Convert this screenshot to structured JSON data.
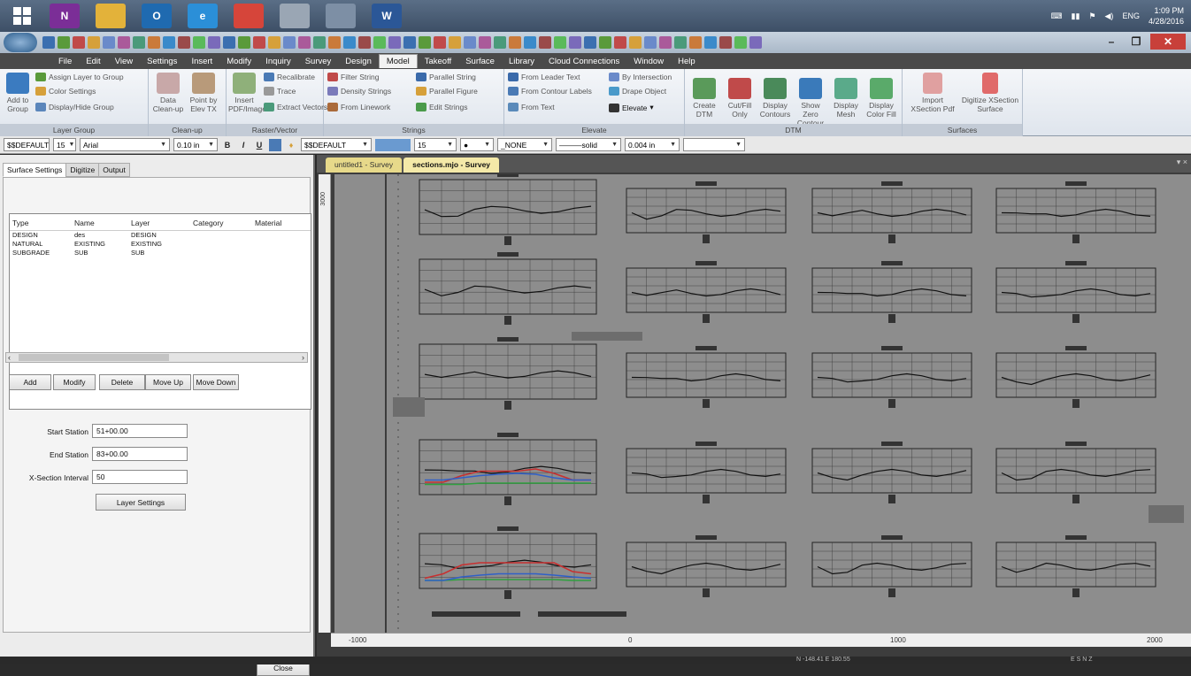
{
  "taskbar": {
    "pinned": [
      {
        "name": "onenote",
        "label": "N",
        "color": "#7b2e97"
      },
      {
        "name": "file-explorer",
        "label": "",
        "color": "#e3b23a"
      },
      {
        "name": "outlook",
        "label": "O",
        "color": "#1f6ab0"
      },
      {
        "name": "internet-explorer",
        "label": "e",
        "color": "#2b8fd8"
      },
      {
        "name": "chrome",
        "label": "",
        "color": "#d6453a"
      },
      {
        "name": "paint",
        "label": "",
        "color": "#9aa6b4"
      },
      {
        "name": "carlson-app",
        "label": "",
        "color": "#7d8fa5"
      },
      {
        "name": "word",
        "label": "W",
        "color": "#2b5797"
      }
    ],
    "tray_lang": "ENG",
    "clock_time": "1:09 PM",
    "clock_date": "4/28/2016"
  },
  "menubar": {
    "items": [
      "File",
      "Edit",
      "View",
      "Settings",
      "Insert",
      "Modify",
      "Inquiry",
      "Survey",
      "Design",
      "Model",
      "Takeoff",
      "Surface",
      "Library",
      "Cloud Connections",
      "Window",
      "Help"
    ],
    "active": "Model"
  },
  "ribbon": {
    "groups": {
      "layer_group": {
        "title": "Layer Group",
        "add_to_group": "Add to Group",
        "assign_layer": "Assign Layer to Group",
        "color_settings": "Color Settings",
        "display_hide": "Display/Hide Group"
      },
      "cleanup": {
        "title": "Clean-up",
        "data_cleanup": "Data Clean-up",
        "point_by_elev": "Point by Elev TX"
      },
      "raster": {
        "title": "Raster/Vector",
        "insert_pdf": "Insert PDF/Image",
        "recalibrate": "Recalibrate",
        "trace": "Trace",
        "extract_vectors": "Extract Vectors"
      },
      "strings": {
        "title": "Strings",
        "filter_string": "Filter String",
        "parallel_string": "Parallel String",
        "density_strings": "Density Strings",
        "parallel_figure": "Parallel Figure",
        "from_linework": "From Linework",
        "edit_strings": "Edit Strings"
      },
      "elevate": {
        "title": "Elevate",
        "from_leader_text": "From Leader Text",
        "by_intersection": "By Intersection",
        "from_contour_labels": "From Contour Labels",
        "drape_object": "Drape Object",
        "from_text": "From Text",
        "elevate": "Elevate"
      },
      "dtm": {
        "title": "DTM",
        "buttons": [
          "Create DTM",
          "Cut/Fill Only",
          "Display Contours",
          "Show Zero Contour",
          "Display Mesh",
          "Display Color Fill"
        ]
      },
      "surfaces": {
        "title": "Surfaces",
        "import": "Import XSection Pdf",
        "digitize": "Digitize XSection Surface"
      }
    }
  },
  "props": {
    "layer": "$$DEFAULT",
    "color": "15",
    "font": "Arial",
    "height": "0.10 in",
    "style": "$$DEFAULT",
    "color2": "15",
    "text_style": "_NONE",
    "linetype": "———solid",
    "lineweight": "0.004 in"
  },
  "left_panel": {
    "tabs": [
      "Surface Settings",
      "Digitize",
      "Output"
    ],
    "active_tab": "Surface Settings",
    "columns": [
      "Type",
      "Name",
      "Layer",
      "Category",
      "Material"
    ],
    "rows": [
      [
        "DESIGN",
        "des",
        "DESIGN",
        "",
        ""
      ],
      [
        "NATURAL",
        "EXISTING",
        "EXISTING",
        "",
        ""
      ],
      [
        "SUBGRADE",
        "SUB",
        "SUB",
        "",
        ""
      ]
    ],
    "buttons": [
      "Add",
      "Modify",
      "Delete",
      "Move Up",
      "Move Down"
    ],
    "start_station_label": "Start Station",
    "start_station": "51+00.00",
    "end_station_label": "End Station",
    "end_station": "83+00.00",
    "interval_label": "X-Section Interval",
    "interval": "50",
    "layer_settings": "Layer Settings",
    "close": "Close"
  },
  "document": {
    "tabs": [
      "untitled1 - Survey",
      "sections.mjo - Survey"
    ],
    "active_tab": "sections.mjo - Survey",
    "vruler_labels": [
      "3000"
    ],
    "hruler_labels": [
      "-1000",
      "0",
      "1000",
      "2000"
    ]
  },
  "status": {
    "coords": "N -148.41  E 180.55",
    "right": "E S N Z"
  }
}
